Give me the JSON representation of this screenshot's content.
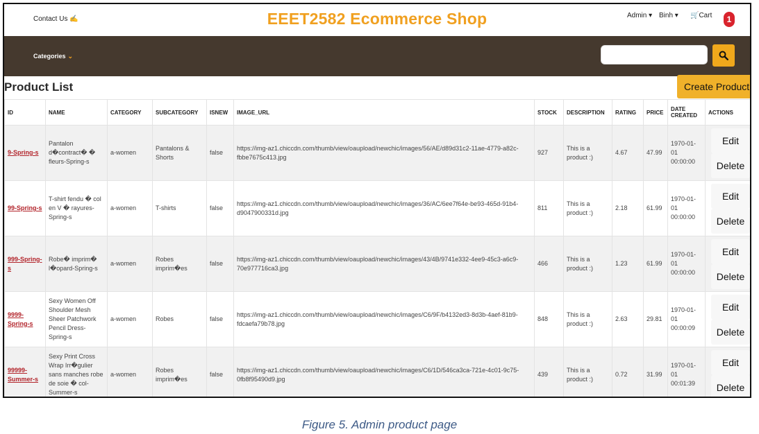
{
  "header": {
    "contact_label": "Contact Us ✍",
    "shop_title": "EEET2582 Ecommerce Shop",
    "admin_label": "Admin ▾",
    "user_label": "Binh ▾",
    "cart_label": "🛒Cart",
    "cart_count": "1"
  },
  "navbar": {
    "categories_label": "Categories",
    "categories_chevron": "⌄",
    "search_placeholder": ""
  },
  "page": {
    "title": "Product List",
    "create_button": "Create Product"
  },
  "table": {
    "headers": [
      "ID",
      "NAME",
      "CATEGORY",
      "SUBCATEGORY",
      "ISNEW",
      "IMAGE_URL",
      "STOCK",
      "DESCRIPTION",
      "RATING",
      "PRICE",
      "DATE CREATED",
      "ACTIONS"
    ],
    "edit_label": "Edit",
    "delete_label": "Delete",
    "rows": [
      {
        "id": "9-Spring-s",
        "name": "Pantalon d�contract� � fleurs-Spring-s",
        "category": "a-women",
        "subcategory": "Pantalons & Shorts",
        "isnew": "false",
        "image_url": "https://img-az1.chiccdn.com/thumb/view/oaupload/newchic/images/56/AE/d89d31c2-11ae-4779-a82c-fbbe7675c413.jpg",
        "stock": "927",
        "description": "This is a product :)",
        "rating": "4.67",
        "price": "47.99",
        "date_created": "1970-01-01 00:00:00"
      },
      {
        "id": "99-Spring-s",
        "name": "T-shirt fendu � col en V � rayures-Spring-s",
        "category": "a-women",
        "subcategory": "T-shirts",
        "isnew": "false",
        "image_url": "https://img-az1.chiccdn.com/thumb/view/oaupload/newchic/images/36/AC/6ee7f64e-be93-465d-91b4-d9047900331d.jpg",
        "stock": "811",
        "description": "This is a product :)",
        "rating": "2.18",
        "price": "61.99",
        "date_created": "1970-01-01 00:00:00"
      },
      {
        "id": "999-Spring-s",
        "name": "Robe� imprim� l�opard-Spring-s",
        "category": "a-women",
        "subcategory": "Robes imprim�es",
        "isnew": "false",
        "image_url": "https://img-az1.chiccdn.com/thumb/view/oaupload/newchic/images/43/4B/9741e332-4ee9-45c3-a6c9-70e977716ca3.jpg",
        "stock": "466",
        "description": "This is a product :)",
        "rating": "1.23",
        "price": "61.99",
        "date_created": "1970-01-01 00:00:00"
      },
      {
        "id": "9999-Spring-s",
        "name": "Sexy Women Off Shoulder Mesh Sheer Patchwork Pencil Dress-Spring-s",
        "category": "a-women",
        "subcategory": "Robes",
        "isnew": "false",
        "image_url": "https://img-az1.chiccdn.com/thumb/view/oaupload/newchic/images/C6/9F/b4132ed3-8d3b-4aef-81b9-fdcaefa79b78.jpg",
        "stock": "848",
        "description": "This is a product :)",
        "rating": "2.63",
        "price": "29.81",
        "date_created": "1970-01-01 00:00:09"
      },
      {
        "id": "99999-Summer-s",
        "name": "Sexy Print Cross Wrap Irr�gulier sans manches robe de soie � col-Summer-s",
        "category": "a-women",
        "subcategory": "Robes imprim�es",
        "isnew": "false",
        "image_url": "https://img-az1.chiccdn.com/thumb/view/oaupload/newchic/images/C6/1D/546ca3ca-721e-4c01-9c75-0fb8f95490d9.jpg",
        "stock": "439",
        "description": "This is a product :)",
        "rating": "0.72",
        "price": "31.99",
        "date_created": "1970-01-01 00:01:39"
      }
    ]
  },
  "caption": "Figure 5. Admin product page"
}
